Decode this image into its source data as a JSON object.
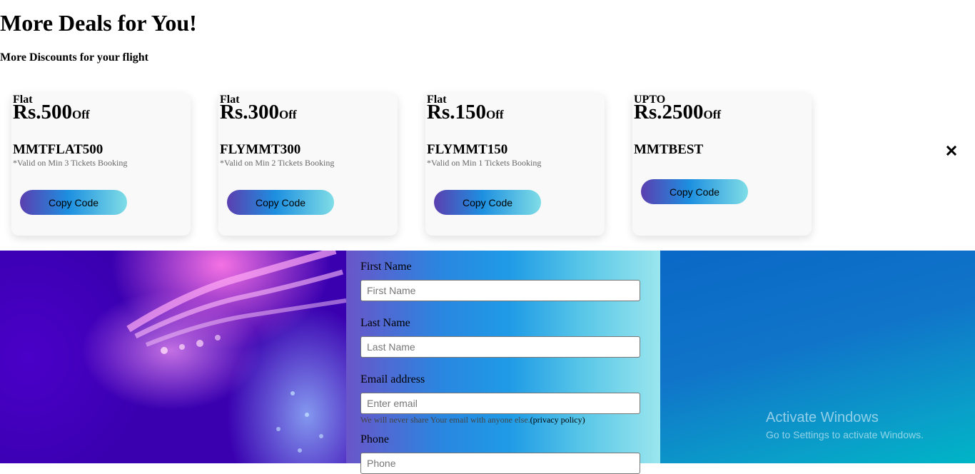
{
  "header": {
    "title": "More Deals for You!",
    "subtitle": "More Discounts for your flight"
  },
  "deals": [
    {
      "tag": "Flat",
      "amount": "Rs.500",
      "suffix": "Off",
      "code": "MMTFLAT500",
      "note": "*Valid on Min 3 Tickets Booking",
      "button": "Copy Code"
    },
    {
      "tag": "Flat",
      "amount": "Rs.300",
      "suffix": "Off",
      "code": "FLYMMT300",
      "note": "*Valid on Min 2 Tickets Booking",
      "button": "Copy Code"
    },
    {
      "tag": "Flat",
      "amount": "Rs.150",
      "suffix": "Off",
      "code": "FLYMMT150",
      "note": "*Valid on Min 1 Tickets Booking",
      "button": "Copy Code"
    },
    {
      "tag": "UPTO",
      "amount": "Rs.2500",
      "suffix": "Off",
      "code": "MMTBEST",
      "note": "",
      "button": "Copy Code"
    }
  ],
  "close_icon": "close-icon",
  "form": {
    "first_name_label": "First Name",
    "first_name_placeholder": "First Name",
    "last_name_label": "Last Name",
    "last_name_placeholder": "Last Name",
    "email_label": "Email address",
    "email_placeholder": "Enter email",
    "email_help": "We will never share Your email with anyone else.",
    "privacy_link": "(privacy policy)",
    "phone_label": "Phone",
    "phone_placeholder": "Phone"
  },
  "watermark": {
    "line1": "Activate Windows",
    "line2": "Go to Settings to activate Windows."
  },
  "colors": {
    "button_gradient_start": "#5b3fb0",
    "button_gradient_end": "#7fdde6",
    "card_background": "#f9f9f9"
  }
}
